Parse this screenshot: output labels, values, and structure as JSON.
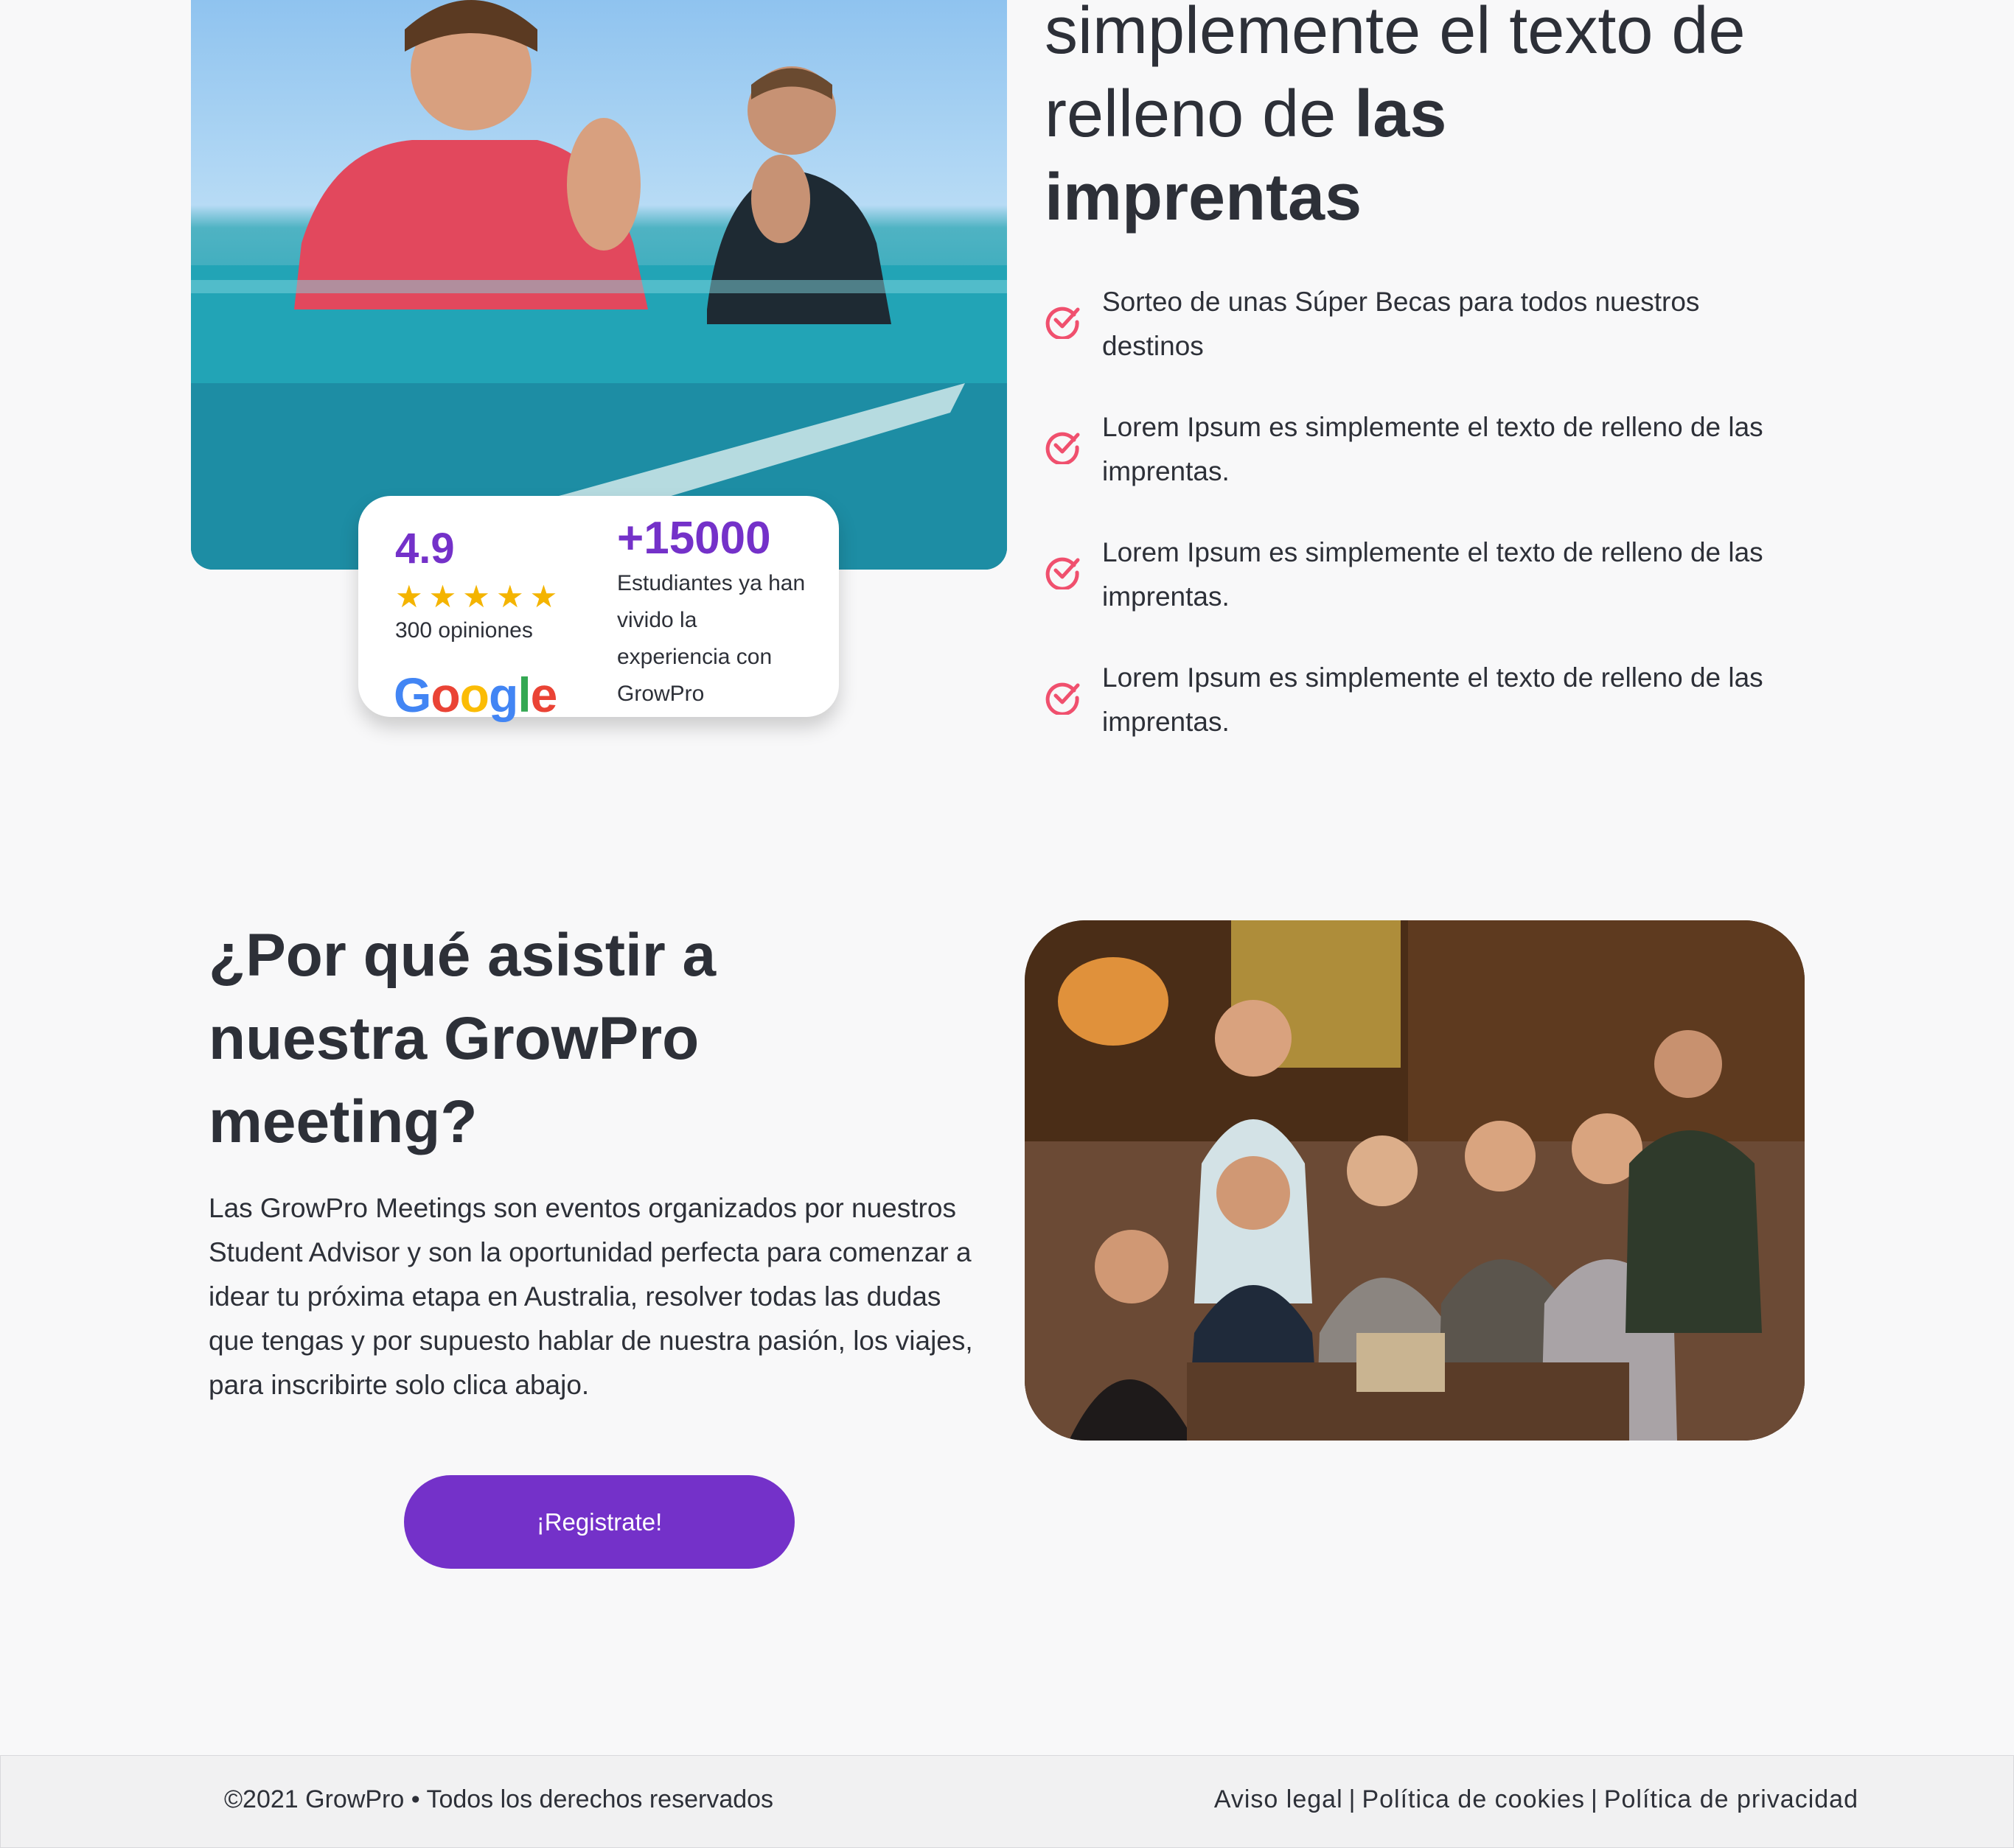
{
  "hero": {
    "title_line1": "simplemente el texto de",
    "title_line2_regular": "relleno de ",
    "title_line2_bold": "las",
    "title_line3_bold": "imprentas"
  },
  "rating_card": {
    "score": "4.9",
    "stars": "★★★★★",
    "star_count": 5,
    "reviews": "300 opiniones",
    "google_letters": [
      "G",
      "o",
      "o",
      "g",
      "l",
      "e"
    ],
    "students_count": "+15000",
    "students_text": "Estudiantes ya han vivido la experiencia con GrowPro"
  },
  "benefits": [
    "Sorteo de unas Súper Becas para todos nuestros destinos",
    "Lorem Ipsum es simplemente el texto de relleno de las imprentas.",
    "Lorem Ipsum es simplemente el texto de relleno de las imprentas.",
    "Lorem Ipsum es simplemente el texto de relleno de las imprentas."
  ],
  "why": {
    "title": "¿Por qué asistir a nuestra GrowPro meeting?",
    "text": "Las GrowPro Meetings son eventos organizados por nuestros Student Advisor y son la oportunidad perfecta para comenzar a idear tu próxima etapa en Australia, resolver todas las dudas que tengas y por supuesto hablar de nuestra pasión, los viajes, para inscribirte solo clica abajo.",
    "button_label": "¡Registrate!"
  },
  "footer": {
    "copyright": "©2021 GrowPro • Todos los derechos reservados",
    "links": [
      "Aviso legal",
      "Política de cookies",
      "Política de privacidad"
    ],
    "separator": "|"
  },
  "colors": {
    "accent": "#7431c9",
    "check": "#f0506e",
    "star": "#f4b400",
    "text": "#2d3038",
    "background": "#f8f8f9"
  }
}
